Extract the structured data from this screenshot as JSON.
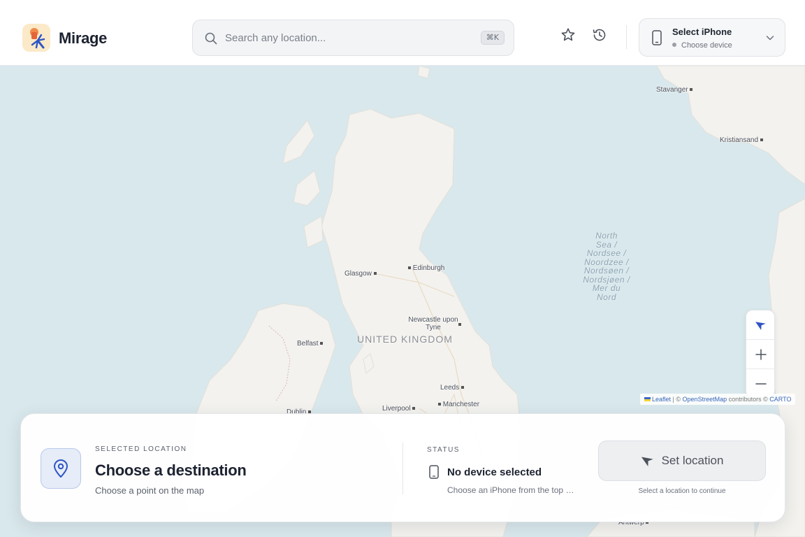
{
  "app": {
    "name": "Mirage"
  },
  "search": {
    "placeholder": "Search any location...",
    "shortcut": "⌘K"
  },
  "header_actions": [
    {
      "name": "favorites",
      "icon": "star-icon"
    },
    {
      "name": "history",
      "icon": "history-icon"
    }
  ],
  "device_selector": {
    "title": "Select iPhone",
    "subtitle": "Choose device"
  },
  "map": {
    "places": [
      {
        "label": "Stavanger"
      },
      {
        "label": "Kristiansand"
      },
      {
        "label": "Glasgow"
      },
      {
        "label": "Edinburgh"
      },
      {
        "label": "Newcastle upon Tyne"
      },
      {
        "label": "Belfast"
      },
      {
        "label": "Leeds"
      },
      {
        "label": "Liverpool"
      },
      {
        "label": "Manchester"
      },
      {
        "label": "Dublin"
      },
      {
        "label": "Antwerp"
      }
    ],
    "country_label": "UNITED KINGDOM",
    "sea_label": "North Sea / Nordsee / Noordzee / Nordsøen / Nordsjøen / Mer du Nord",
    "sea_lines": [
      "North",
      "Sea /",
      "Nordsee /",
      "Noordzee /",
      "Nordsøen /",
      "Nordsjøen /",
      "Mer du",
      "Nord"
    ],
    "attribution": {
      "leaflet": "Leaflet",
      "sep": "| ©",
      "osm": "OpenStreetMap",
      "contrib": "contributors ©",
      "carto": "CARTO"
    }
  },
  "panel": {
    "selected_label": "SELECTED LOCATION",
    "selected_title": "Choose a destination",
    "selected_subtitle": "Choose a point on the map",
    "status_label": "STATUS",
    "status_title": "No device selected",
    "status_subtitle": "Choose an iPhone from the top menu",
    "set_button": "Set location",
    "hint": "Select a location to continue"
  },
  "colors": {
    "accent": "#2f55c4",
    "water": "#d9e8ec",
    "land": "#f3f2ee"
  }
}
